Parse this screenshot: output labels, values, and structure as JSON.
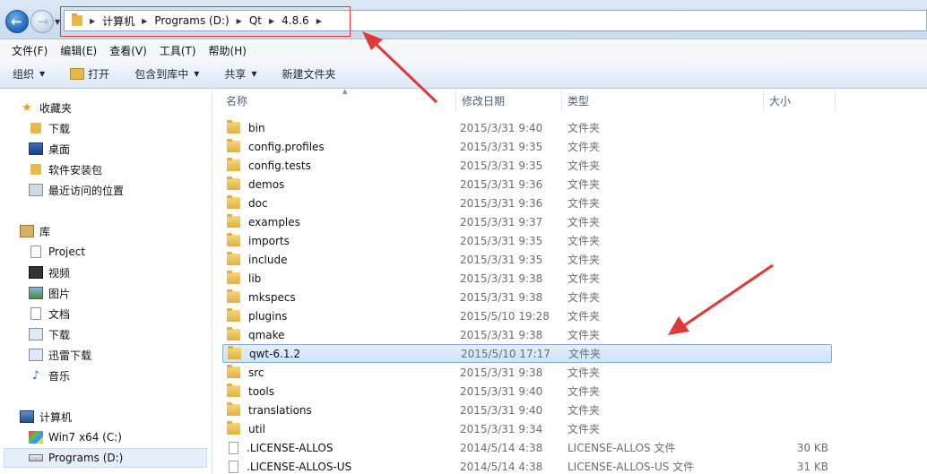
{
  "addressbar": {
    "back_label": "←",
    "forward_label": "→",
    "breadcrumbs": [
      "计算机",
      "Programs (D:)",
      "Qt",
      "4.8.6"
    ]
  },
  "menubar": [
    "文件(F)",
    "编辑(E)",
    "查看(V)",
    "工具(T)",
    "帮助(H)"
  ],
  "toolbar": {
    "organize": "组织",
    "open": "打开",
    "include_in_library": "包含到库中",
    "share": "共享",
    "new_folder": "新建文件夹"
  },
  "navpane": {
    "favorites": "收藏夹",
    "downloads": "下载",
    "desktop": "桌面",
    "software": "软件安装包",
    "recent": "最近访问的位置",
    "libraries": "库",
    "project": "Project",
    "videos": "视频",
    "pictures": "图片",
    "documents": "文档",
    "downloads2": "下载",
    "thunder": "迅雷下载",
    "music": "音乐",
    "computer": "计算机",
    "drive_c": "Win7 x64 (C:)",
    "drive_d": "Programs (D:)"
  },
  "columns": {
    "name": "名称",
    "modified": "修改日期",
    "type": "类型",
    "size": "大小"
  },
  "files": [
    {
      "name": "bin",
      "date": "2015/3/31 9:40",
      "type": "文件夹",
      "size": "",
      "kind": "folder"
    },
    {
      "name": "config.profiles",
      "date": "2015/3/31 9:35",
      "type": "文件夹",
      "size": "",
      "kind": "folder"
    },
    {
      "name": "config.tests",
      "date": "2015/3/31 9:35",
      "type": "文件夹",
      "size": "",
      "kind": "folder"
    },
    {
      "name": "demos",
      "date": "2015/3/31 9:36",
      "type": "文件夹",
      "size": "",
      "kind": "folder"
    },
    {
      "name": "doc",
      "date": "2015/3/31 9:36",
      "type": "文件夹",
      "size": "",
      "kind": "folder"
    },
    {
      "name": "examples",
      "date": "2015/3/31 9:37",
      "type": "文件夹",
      "size": "",
      "kind": "folder"
    },
    {
      "name": "imports",
      "date": "2015/3/31 9:35",
      "type": "文件夹",
      "size": "",
      "kind": "folder"
    },
    {
      "name": "include",
      "date": "2015/3/31 9:35",
      "type": "文件夹",
      "size": "",
      "kind": "folder"
    },
    {
      "name": "lib",
      "date": "2015/3/31 9:38",
      "type": "文件夹",
      "size": "",
      "kind": "folder"
    },
    {
      "name": "mkspecs",
      "date": "2015/3/31 9:38",
      "type": "文件夹",
      "size": "",
      "kind": "folder"
    },
    {
      "name": "plugins",
      "date": "2015/5/10 19:28",
      "type": "文件夹",
      "size": "",
      "kind": "folder"
    },
    {
      "name": "qmake",
      "date": "2015/3/31 9:38",
      "type": "文件夹",
      "size": "",
      "kind": "folder"
    },
    {
      "name": "qwt-6.1.2",
      "date": "2015/5/10 17:17",
      "type": "文件夹",
      "size": "",
      "kind": "folder",
      "selected": true
    },
    {
      "name": "src",
      "date": "2015/3/31 9:38",
      "type": "文件夹",
      "size": "",
      "kind": "folder"
    },
    {
      "name": "tools",
      "date": "2015/3/31 9:40",
      "type": "文件夹",
      "size": "",
      "kind": "folder"
    },
    {
      "name": "translations",
      "date": "2015/3/31 9:40",
      "type": "文件夹",
      "size": "",
      "kind": "folder"
    },
    {
      "name": "util",
      "date": "2015/3/31 9:34",
      "type": "文件夹",
      "size": "",
      "kind": "folder"
    },
    {
      "name": ".LICENSE-ALLOS",
      "date": "2014/5/14 4:38",
      "type": "LICENSE-ALLOS 文件",
      "size": "30 KB",
      "kind": "file"
    },
    {
      "name": ".LICENSE-ALLOS-US",
      "date": "2014/5/14 4:38",
      "type": "LICENSE-ALLOS-US 文件",
      "size": "31 KB",
      "kind": "file"
    }
  ],
  "colors": {
    "annotation_red": "#e0393a",
    "selection_border": "#84acdd"
  }
}
